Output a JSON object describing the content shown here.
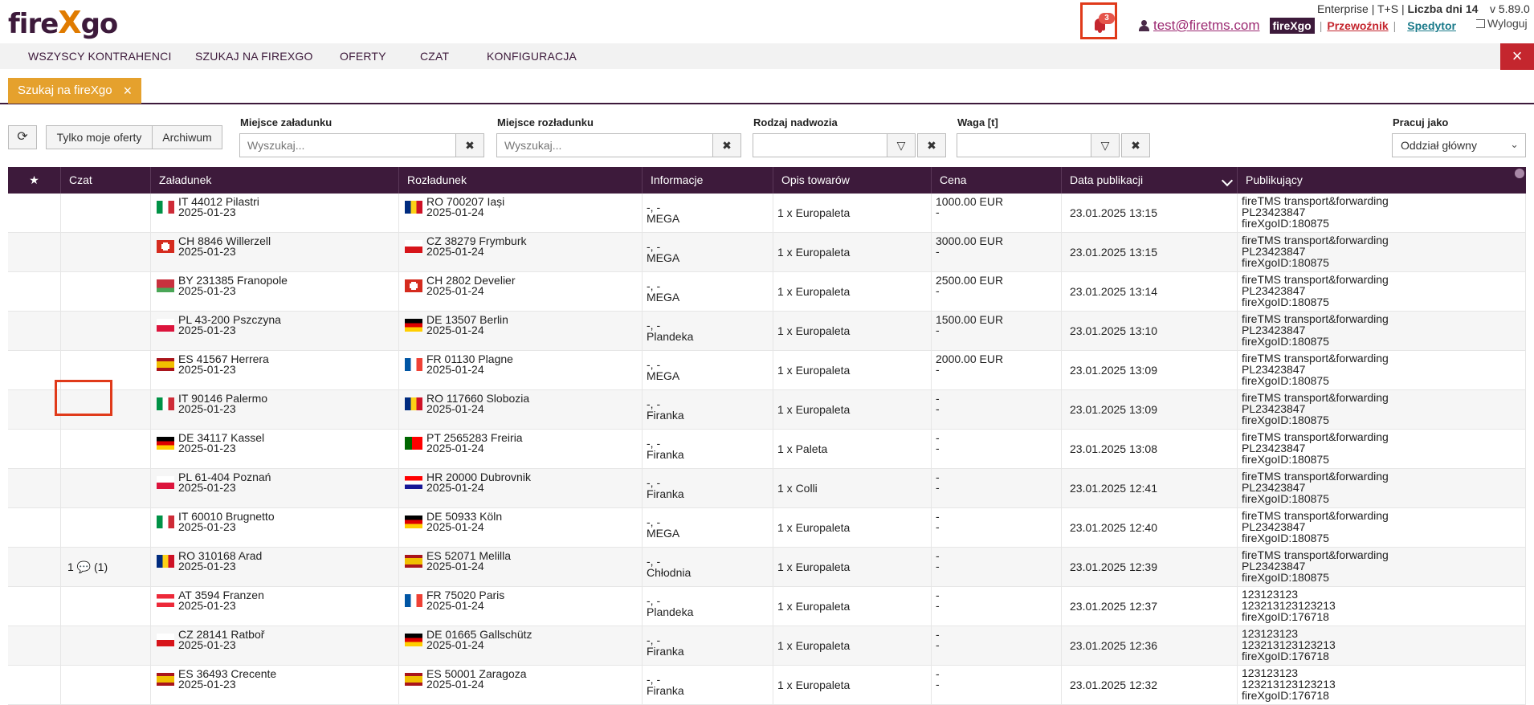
{
  "header": {
    "logo_a": "fire",
    "logo_x": "X",
    "logo_b": "go",
    "notifications": "3",
    "email": "test@firetms.com",
    "fx_badge": "fireXgo",
    "carrier": "Przewoźnik",
    "shipper": "Spedytor",
    "plan": "Enterprise",
    "plan2": "T+S",
    "days": "Liczba dni 14",
    "version": "v 5.89.0",
    "logout": "Wyloguj"
  },
  "nav": [
    "WSZYSCY KONTRAHENCI",
    "SZUKAJ NA FIREXGO",
    "OFERTY",
    "CZAT",
    "KONFIGURACJA"
  ],
  "tab": {
    "label": "Szukaj na fireXgo",
    "close": "×"
  },
  "filters": {
    "own": "Tylko moje oferty",
    "archive": "Archiwum",
    "loading_label": "Miejsce załadunku",
    "loading_ph": "Wyszukaj...",
    "unloading_label": "Miejsce rozładunku",
    "unloading_ph": "Wyszukaj...",
    "body_label": "Rodzaj nadwozia",
    "weight_label": "Waga [t]",
    "work_label": "Pracuj jako",
    "work_value": "Oddział główny"
  },
  "columns": [
    "★",
    "Czat",
    "Załadunek",
    "Rozładunek",
    "Informacje",
    "Opis towarów",
    "Cena",
    "Data publikacji",
    "Publikujący"
  ],
  "rows": [
    {
      "chat": "",
      "lf": "it",
      "lp": "IT 44012 Pilastri",
      "ld": "2025-01-23",
      "uf": "ro",
      "up": "RO 700207 Iași",
      "ud": "2025-01-24",
      "info1": "-, -",
      "info2": "MEGA",
      "goods": "1 x Europaleta",
      "p1": "1000.00 EUR",
      "p2": "-",
      "date": "23.01.2025 13:15",
      "pb1": "fireTMS transport&forwarding",
      "pb2": "PL23423847",
      "pb3": "fireXgoID:180875"
    },
    {
      "chat": "",
      "lf": "ch",
      "lp": "CH 8846 Willerzell",
      "ld": "2025-01-23",
      "uf": "cz",
      "up": "CZ 38279 Frymburk",
      "ud": "2025-01-24",
      "info1": "-, -",
      "info2": "MEGA",
      "goods": "1 x Europaleta",
      "p1": "3000.00 EUR",
      "p2": "-",
      "date": "23.01.2025 13:15",
      "pb1": "fireTMS transport&forwarding",
      "pb2": "PL23423847",
      "pb3": "fireXgoID:180875"
    },
    {
      "chat": "",
      "lf": "by",
      "lp": "BY 231385 Franopole",
      "ld": "2025-01-23",
      "uf": "ch",
      "up": "CH 2802 Develier",
      "ud": "2025-01-24",
      "info1": "-, -",
      "info2": "MEGA",
      "goods": "1 x Europaleta",
      "p1": "2500.00 EUR",
      "p2": "-",
      "date": "23.01.2025 13:14",
      "pb1": "fireTMS transport&forwarding",
      "pb2": "PL23423847",
      "pb3": "fireXgoID:180875"
    },
    {
      "chat": "",
      "lf": "pl",
      "lp": "PL 43-200 Pszczyna",
      "ld": "2025-01-23",
      "uf": "de",
      "up": "DE 13507 Berlin",
      "ud": "2025-01-24",
      "info1": "-, -",
      "info2": "Plandeka",
      "goods": "1 x Europaleta",
      "p1": "1500.00 EUR",
      "p2": "-",
      "date": "23.01.2025 13:10",
      "pb1": "fireTMS transport&forwarding",
      "pb2": "PL23423847",
      "pb3": "fireXgoID:180875"
    },
    {
      "chat": "",
      "lf": "es",
      "lp": "ES 41567 Herrera",
      "ld": "2025-01-23",
      "uf": "fr",
      "up": "FR 01130 Plagne",
      "ud": "2025-01-24",
      "info1": "-, -",
      "info2": "MEGA",
      "goods": "1 x Europaleta",
      "p1": "2000.00 EUR",
      "p2": "-",
      "date": "23.01.2025 13:09",
      "pb1": "fireTMS transport&forwarding",
      "pb2": "PL23423847",
      "pb3": "fireXgoID:180875"
    },
    {
      "chat": "",
      "lf": "it",
      "lp": "IT 90146 Palermo",
      "ld": "2025-01-23",
      "uf": "ro",
      "up": "RO 117660 Slobozia",
      "ud": "2025-01-24",
      "info1": "-, -",
      "info2": "Firanka",
      "goods": "1 x Europaleta",
      "p1": "-",
      "p2": "-",
      "date": "23.01.2025 13:09",
      "pb1": "fireTMS transport&forwarding",
      "pb2": "PL23423847",
      "pb3": "fireXgoID:180875"
    },
    {
      "chat": "",
      "lf": "de",
      "lp": "DE 34117 Kassel",
      "ld": "2025-01-23",
      "uf": "pt",
      "up": "PT 2565283 Freiria",
      "ud": "2025-01-24",
      "info1": "-, -",
      "info2": "Firanka",
      "goods": "1 x Paleta",
      "p1": "-",
      "p2": "-",
      "date": "23.01.2025 13:08",
      "pb1": "fireTMS transport&forwarding",
      "pb2": "PL23423847",
      "pb3": "fireXgoID:180875"
    },
    {
      "chat": "",
      "lf": "pl",
      "lp": "PL 61-404 Poznań",
      "ld": "2025-01-23",
      "uf": "hr",
      "up": "HR 20000 Dubrovnik",
      "ud": "2025-01-24",
      "info1": "-, -",
      "info2": "Firanka",
      "goods": "1 x Colli",
      "p1": "-",
      "p2": "-",
      "date": "23.01.2025 12:41",
      "pb1": "fireTMS transport&forwarding",
      "pb2": "PL23423847",
      "pb3": "fireXgoID:180875"
    },
    {
      "chat": "",
      "lf": "it",
      "lp": "IT 60010 Brugnetto",
      "ld": "2025-01-23",
      "uf": "de",
      "up": "DE 50933 Köln",
      "ud": "2025-01-24",
      "info1": "-, -",
      "info2": "MEGA",
      "goods": "1 x Europaleta",
      "p1": "-",
      "p2": "-",
      "date": "23.01.2025 12:40",
      "pb1": "fireTMS transport&forwarding",
      "pb2": "PL23423847",
      "pb3": "fireXgoID:180875"
    },
    {
      "chat": "1 💬 (1)",
      "lf": "ro",
      "lp": "RO 310168 Arad",
      "ld": "2025-01-23",
      "uf": "es",
      "up": "ES 52071 Melilla",
      "ud": "2025-01-24",
      "info1": "-, -",
      "info2": "Chłodnia",
      "goods": "1 x Europaleta",
      "p1": "-",
      "p2": "-",
      "date": "23.01.2025 12:39",
      "pb1": "fireTMS transport&forwarding",
      "pb2": "PL23423847",
      "pb3": "fireXgoID:180875"
    },
    {
      "chat": "",
      "lf": "at",
      "lp": "AT 3594 Franzen",
      "ld": "2025-01-23",
      "uf": "fr",
      "up": "FR 75020 Paris",
      "ud": "2025-01-24",
      "info1": "-, -",
      "info2": "Plandeka",
      "goods": "1 x Europaleta",
      "p1": "-",
      "p2": "-",
      "date": "23.01.2025 12:37",
      "pb1": "123123123",
      "pb2": "123213123123213",
      "pb3": "fireXgoID:176718"
    },
    {
      "chat": "",
      "lf": "cz",
      "lp": "CZ 28141 Ratboř",
      "ld": "2025-01-23",
      "uf": "de",
      "up": "DE 01665 Gallschütz",
      "ud": "2025-01-24",
      "info1": "-, -",
      "info2": "Firanka",
      "goods": "1 x Europaleta",
      "p1": "-",
      "p2": "-",
      "date": "23.01.2025 12:36",
      "pb1": "123123123",
      "pb2": "123213123123213",
      "pb3": "fireXgoID:176718"
    },
    {
      "chat": "",
      "lf": "es",
      "lp": "ES 36493 Crecente",
      "ld": "2025-01-23",
      "uf": "es",
      "up": "ES 50001 Zaragoza",
      "ud": "2025-01-24",
      "info1": "-, -",
      "info2": "Firanka",
      "goods": "1 x Europaleta",
      "p1": "-",
      "p2": "-",
      "date": "23.01.2025 12:32",
      "pb1": "123123123",
      "pb2": "123213123123213",
      "pb3": "fireXgoID:176718"
    }
  ]
}
